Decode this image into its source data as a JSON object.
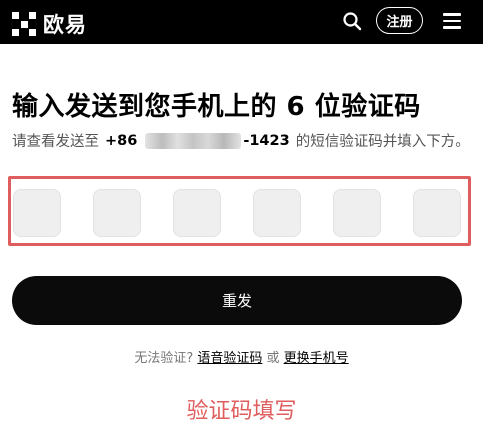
{
  "header": {
    "logo_text": "欧易",
    "logo_icon": "okx-logo-icon",
    "search_icon": "search-icon",
    "signup_label": "注册",
    "menu_icon": "hamburger-menu-icon",
    "background_color": "#000000"
  },
  "main": {
    "title": "输入发送到您手机上的 6 位验证码",
    "subtitle_prefix": "请查看发送至",
    "phone_code": "+86",
    "phone_tail": "-1423",
    "subtitle_suffix": "的短信验证码并填入下方。",
    "code_cells": [
      "",
      "",
      "",
      "",
      "",
      ""
    ],
    "resend_label": "重发",
    "help_prefix": "无法验证?",
    "voice_code_link": "语音验证码",
    "help_or": "或",
    "change_phone_link": "更换手机号"
  },
  "annotation": {
    "text": "验证码填写",
    "color": "#e05d5d"
  }
}
